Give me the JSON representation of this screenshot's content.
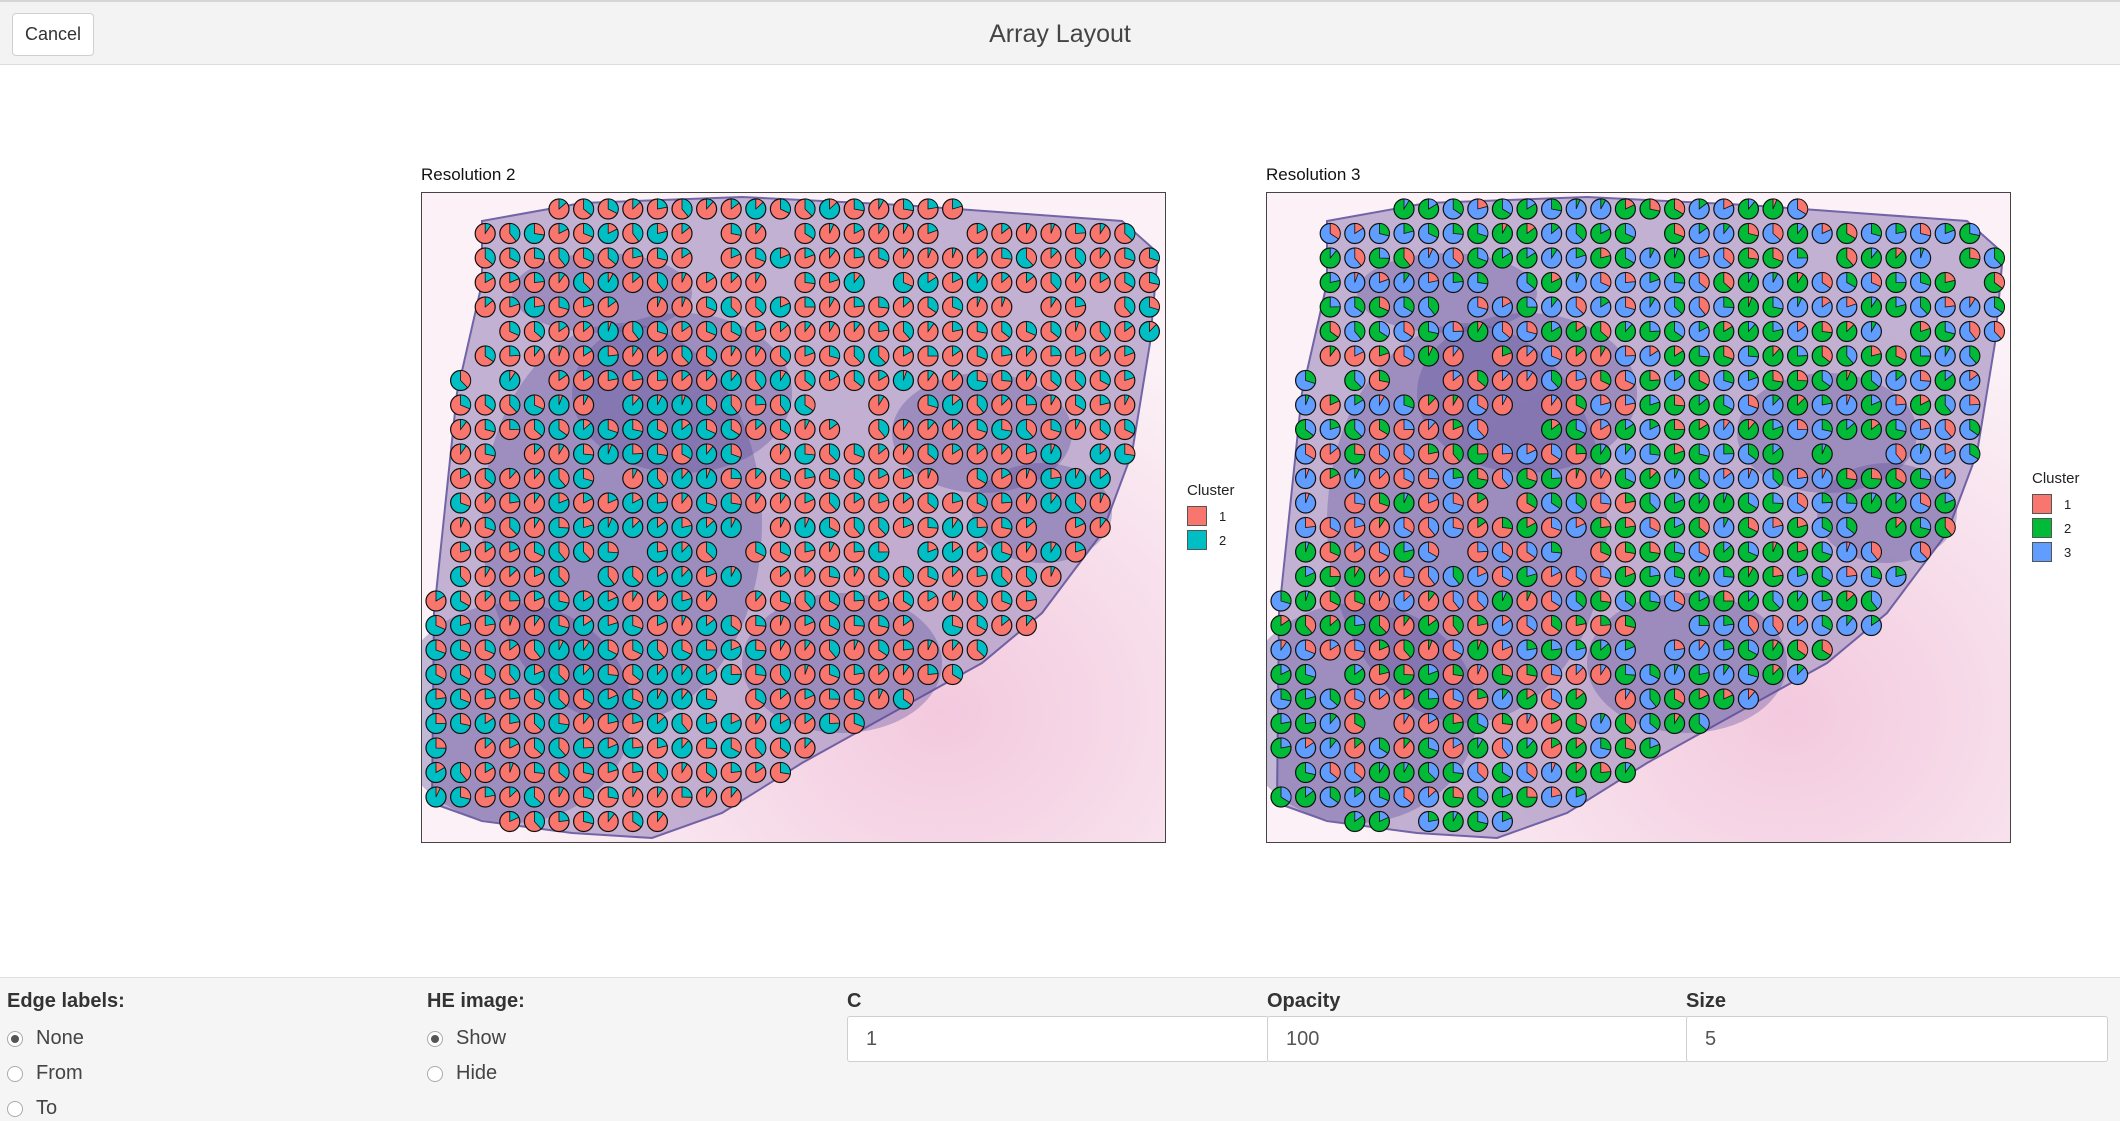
{
  "header": {
    "cancel_label": "Cancel",
    "title": "Array Layout"
  },
  "plots": [
    {
      "title": "Resolution 2",
      "legend_title": "Cluster",
      "clusters": [
        {
          "label": "1",
          "color": "#F8766D"
        },
        {
          "label": "2",
          "color": "#00BFC4"
        }
      ]
    },
    {
      "title": "Resolution 3",
      "legend_title": "Cluster",
      "clusters": [
        {
          "label": "1",
          "color": "#F8766D"
        },
        {
          "label": "2",
          "color": "#00BA38"
        },
        {
          "label": "3",
          "color": "#619CFF"
        }
      ]
    }
  ],
  "controls": {
    "edge_labels": {
      "label": "Edge labels:",
      "options": [
        "None",
        "From",
        "To"
      ],
      "selected": "None"
    },
    "he_image": {
      "label": "HE image:",
      "options": [
        "Show",
        "Hide"
      ],
      "selected": "Show"
    },
    "c": {
      "label": "C",
      "value": "1"
    },
    "opacity": {
      "label": "Opacity",
      "value": "100"
    },
    "size": {
      "label": "Size",
      "value": "5"
    }
  },
  "colors": {
    "tissue_purple": "#5a4c9a",
    "background_pink": "#f6dbe9"
  }
}
